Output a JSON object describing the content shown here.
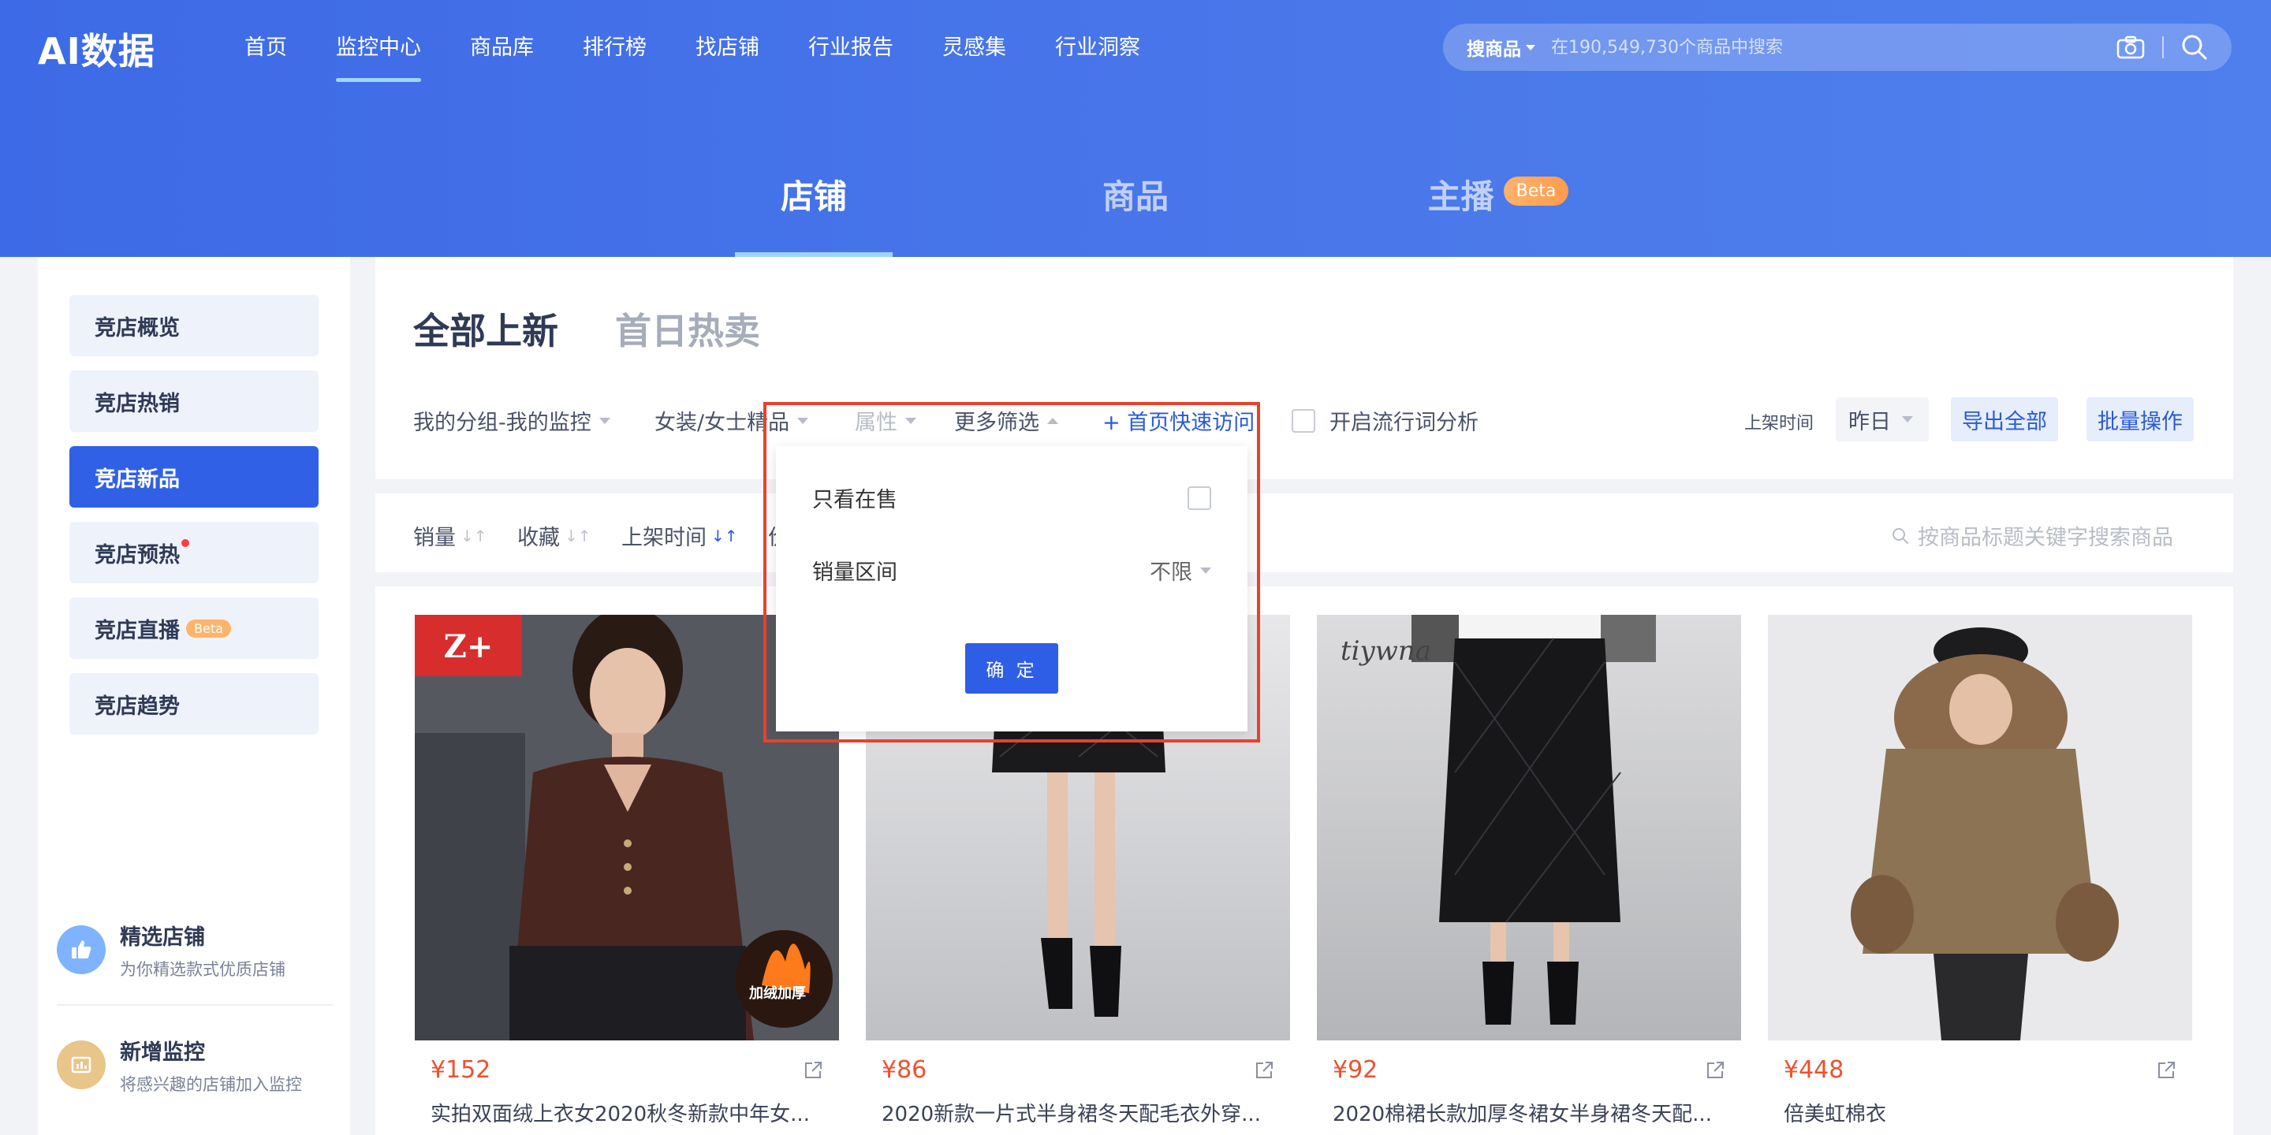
{
  "header": {
    "logo_text": "AI数据",
    "nav": [
      "首页",
      "监控中心",
      "商品库",
      "排行榜",
      "找店铺",
      "行业报告",
      "灵感集",
      "行业洞察"
    ],
    "active_nav": 1,
    "search": {
      "type_label": "搜商品",
      "placeholder": "在190,549,730个商品中搜索"
    }
  },
  "main_tabs": [
    {
      "label": "店铺",
      "active": true
    },
    {
      "label": "商品",
      "active": false
    },
    {
      "label": "主播",
      "badge": "Beta",
      "active": false
    }
  ],
  "sidebar": {
    "items": [
      {
        "label": "竞店概览"
      },
      {
        "label": "竞店热销"
      },
      {
        "label": "竞店新品",
        "active": true
      },
      {
        "label": "竞店预热",
        "dot": true
      },
      {
        "label": "竞店直播",
        "badge": "Beta"
      },
      {
        "label": "竞店趋势"
      }
    ],
    "cards": [
      {
        "title": "精选店铺",
        "desc": "为你精选款式优质店铺"
      },
      {
        "title": "新增监控",
        "desc": "将感兴趣的店铺加入监控"
      }
    ]
  },
  "sub_tabs": [
    "全部上新",
    "首日热卖"
  ],
  "filters": {
    "group": "我的分组-我的监控",
    "category": "女装/女士精品",
    "attr": "属性",
    "more": "更多筛选",
    "quick": "+ 首页快速访问",
    "trend_toggle": "开启流行词分析",
    "time_label": "上架时间",
    "time_value": "昨日",
    "export": "导出全部",
    "batch": "批量操作"
  },
  "sort": {
    "items": [
      "销量",
      "收藏",
      "上架时间",
      "价"
    ],
    "search_placeholder": "按商品标题关键字搜索商品"
  },
  "dropdown": {
    "on_sale_label": "只看在售",
    "sales_range_label": "销量区间",
    "sales_range_value": "不限",
    "confirm": "确 定"
  },
  "products": [
    {
      "price": "¥152",
      "title": "实拍双面绒上衣女2020秋冬新款中年女...",
      "badge": "加绒加厚"
    },
    {
      "price": "¥86",
      "title": "2020新款一片式半身裙冬天配毛衣外穿..."
    },
    {
      "price": "¥92",
      "title": "2020棉裙长款加厚冬裙女半身裙冬天配...",
      "brand": "tiywna"
    },
    {
      "price": "¥448",
      "title": "倍美虹棉衣"
    }
  ],
  "colors": {
    "header_blue": "#3d6ae6",
    "accent": "#3060e6",
    "price": "#f0502e",
    "highlight": "#e8412c"
  }
}
